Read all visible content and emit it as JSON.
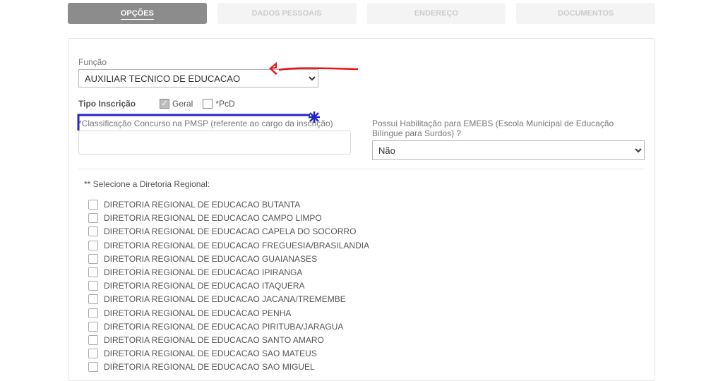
{
  "tabs": {
    "opcoes": "OPÇÕES",
    "dados": "DADOS PESSOAIS",
    "endereco": "ENDEREÇO",
    "documentos": "DOCUMENTOS"
  },
  "labels": {
    "funcao": "Função",
    "tipo_inscricao": "Tipo Inscrição",
    "geral": "Geral",
    "pcd": "*PcD",
    "classificacao": "*Classificação Concurso na PMSP (referente ao cargo da inscrição)",
    "emebs": "Possui Habilitação para EMEBS (Escola Municipal de Educação Bilíngue para Surdos) ?",
    "diretoria_title": "** Selecione a Diretoria Regional:"
  },
  "values": {
    "funcao_selected": "AUXILIAR TECNICO DE EDUCACAO",
    "classificacao_value": "",
    "emebs_selected": "Não"
  },
  "diretorias": [
    "DIRETORIA REGIONAL DE EDUCACAO BUTANTA",
    "DIRETORIA REGIONAL DE EDUCACAO CAMPO LIMPO",
    "DIRETORIA REGIONAL DE EDUCACAO CAPELA DO SOCORRO",
    "DIRETORIA REGIONAL DE EDUCACAO FREGUESIA/BRASILANDIA",
    "DIRETORIA REGIONAL DE EDUCACAO GUAIANASES",
    "DIRETORIA REGIONAL DE EDUCACAO IPIRANGA",
    "DIRETORIA REGIONAL DE EDUCACAO ITAQUERA",
    "DIRETORIA REGIONAL DE EDUCACAO JACANA/TREMEMBE",
    "DIRETORIA REGIONAL DE EDUCACAO PENHA",
    "DIRETORIA REGIONAL DE EDUCACAO PIRITUBA/JARAGUA",
    "DIRETORIA REGIONAL DE EDUCACAO SANTO AMARO",
    "DIRETORIA REGIONAL DE EDUCACAO SAO MATEUS",
    "DIRETORIA REGIONAL DE EDUCACAO SAO MIGUEL"
  ]
}
